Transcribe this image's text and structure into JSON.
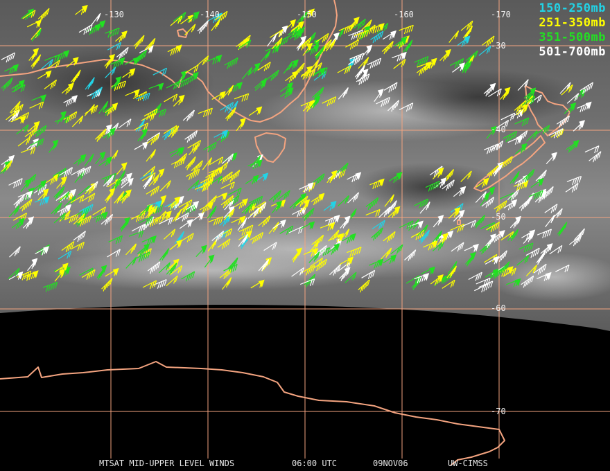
{
  "title": "MTSAT MID-UPPER LEVEL WINDS",
  "time": "06:00 UTC",
  "date": "09NOV06",
  "credit": "UW-CIMSS",
  "legend": [
    {
      "label": "150-250mb",
      "color": "#22d3e6"
    },
    {
      "label": "251-350mb",
      "color": "#ffff00"
    },
    {
      "label": "351-500mb",
      "color": "#22e022"
    },
    {
      "label": "501-700mb",
      "color": "#ffffff"
    }
  ],
  "longitude_labels": [
    "-130",
    "-140",
    "-150",
    "-160",
    "-170"
  ],
  "latitude_labels": [
    "-30",
    "-40",
    "-50",
    "-60",
    "-70"
  ],
  "colors": {
    "grid": "#f4a480",
    "coast": "#f4a480",
    "satellite_dark": "#000000",
    "satellite_mid": "#7a7a7a"
  }
}
